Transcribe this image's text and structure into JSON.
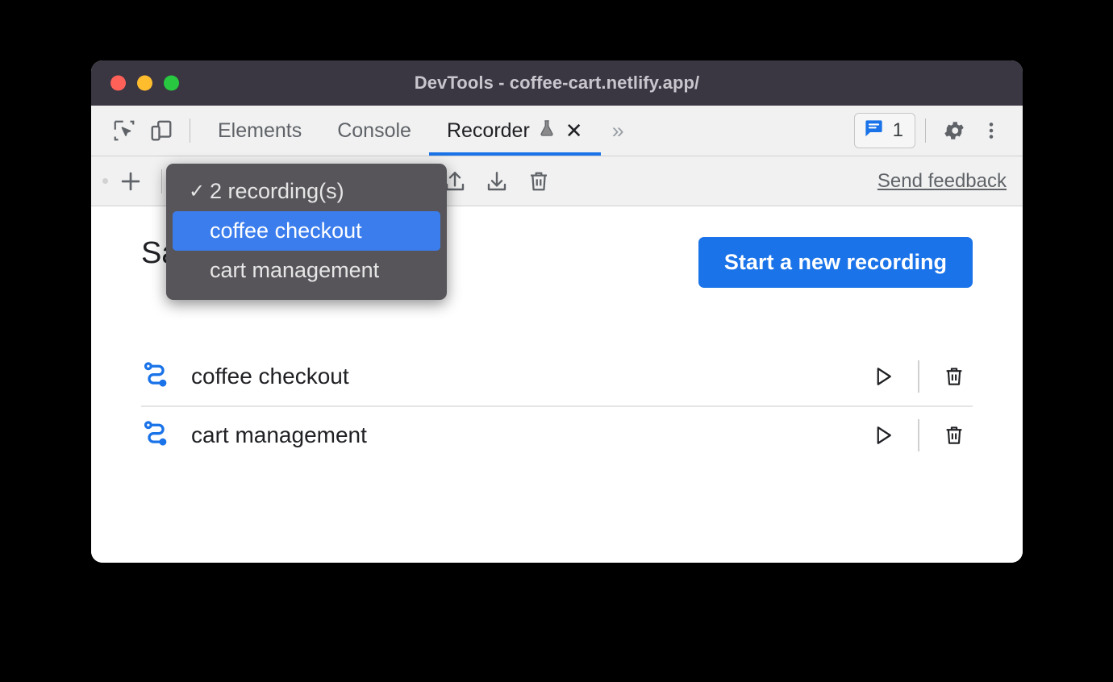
{
  "window": {
    "title": "DevTools - coffee-cart.netlify.app/",
    "traffic_lights": [
      {
        "name": "close",
        "color": "#ff6159"
      },
      {
        "name": "minimize",
        "color": "#ffbd2e"
      },
      {
        "name": "zoom",
        "color": "#28c840"
      }
    ]
  },
  "tabbar": {
    "icons": [
      {
        "name": "inspect-element-icon"
      },
      {
        "name": "device-toolbar-icon"
      }
    ],
    "tabs": [
      {
        "label": "Elements",
        "active": false
      },
      {
        "label": "Console",
        "active": false
      },
      {
        "label": "Recorder",
        "active": true,
        "experimental": true,
        "closable": true
      }
    ],
    "more_tabs_label": "»",
    "close_label": "✕",
    "issues_count": "1",
    "right_icons": [
      {
        "name": "issues-icon"
      },
      {
        "name": "settings-gear-icon"
      },
      {
        "name": "more-options-icon"
      }
    ]
  },
  "recorder_toolbar": {
    "add_label": "+",
    "selected_recording": "2 recording(s)",
    "buttons": [
      {
        "name": "add-recording-button",
        "label": "+"
      },
      {
        "name": "export-recording-button",
        "label": "Export"
      },
      {
        "name": "import-recording-button",
        "label": "Import"
      },
      {
        "name": "delete-recording-button",
        "label": "Delete"
      }
    ],
    "send_feedback_label": "Send feedback"
  },
  "dropdown": {
    "items": [
      {
        "label": "2 recording(s)",
        "checked": true,
        "selected": false
      },
      {
        "label": "coffee checkout",
        "checked": false,
        "selected": true
      },
      {
        "label": "cart management",
        "checked": false,
        "selected": false
      }
    ],
    "check_glyph": "✓"
  },
  "panel": {
    "title": "Saved recordings",
    "start_button_label": "Start a new recording",
    "recordings": [
      {
        "name": "coffee checkout"
      },
      {
        "name": "cart management"
      }
    ],
    "row_actions": {
      "replay_label": "Replay",
      "delete_label": "Delete"
    }
  },
  "colors": {
    "accent_blue": "#1a73e8",
    "dropdown_highlight": "#3b7ded",
    "titlebar": "#3a3642",
    "toolbar": "#f1f1f1",
    "menu_bg": "#57555a"
  }
}
